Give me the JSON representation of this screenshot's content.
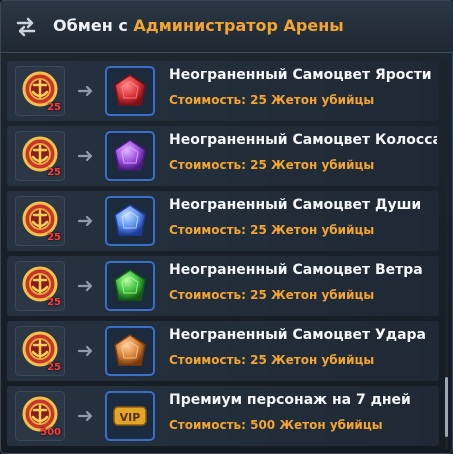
{
  "header": {
    "prefix": "Обмен с",
    "npc": "Администратор Арены",
    "icon": "swap-arrows-icon"
  },
  "colors": {
    "accent": "#f2a531",
    "count": "#ff3b3b",
    "slot_border": "#3a6ec8"
  },
  "items": [
    {
      "name": "Неограненный Самоцвет Ярости",
      "cost": "Стоимость: 25 Жетон убийцы",
      "token_count": "25",
      "icon": "red-gem-icon"
    },
    {
      "name": "Неограненный Самоцвет Колосса",
      "cost": "Стоимость: 25 Жетон убийцы",
      "token_count": "25",
      "icon": "purple-gem-icon"
    },
    {
      "name": "Неограненный Самоцвет Души",
      "cost": "Стоимость: 25 Жетон убийцы",
      "token_count": "25",
      "icon": "blue-gem-icon"
    },
    {
      "name": "Неограненный Самоцвет Ветра",
      "cost": "Стоимость: 25 Жетон убийцы",
      "token_count": "25",
      "icon": "green-gem-icon"
    },
    {
      "name": "Неограненный Самоцвет Удара",
      "cost": "Стоимость: 25 Жетон убийцы",
      "token_count": "25",
      "icon": "orange-gem-icon"
    },
    {
      "name": "Премиум персонаж на 7 дней",
      "cost": "Стоимость: 500 Жетон убийцы",
      "token_count": "500",
      "icon": "vip-ticket-icon",
      "vip_label": "VIP"
    }
  ]
}
